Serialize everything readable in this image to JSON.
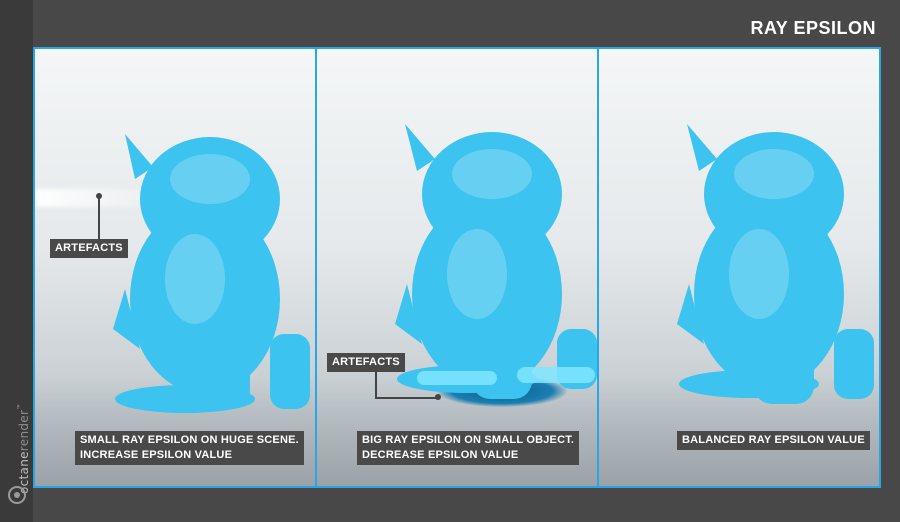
{
  "title": "RAY EPSILON",
  "brand": {
    "name_part1": "octane",
    "name_part2": "render",
    "tm": "™"
  },
  "colors": {
    "frame": "#29a6e6",
    "model": "#3cc3ef",
    "label_bg": "#494949",
    "background": "#484848"
  },
  "panels": [
    {
      "caption_line1": "SMALL RAY EPSILON ON HUGE SCENE.",
      "caption_line2": "INCREASE EPSILON VALUE",
      "annotation": "ARTEFACTS"
    },
    {
      "caption_line1": "BIG RAY EPSILON ON SMALL OBJECT.",
      "caption_line2": "DECREASE EPSILON VALUE",
      "annotation": "ARTEFACTS"
    },
    {
      "caption_line1": "BALANCED RAY EPSILON VALUE",
      "caption_line2": ""
    }
  ]
}
